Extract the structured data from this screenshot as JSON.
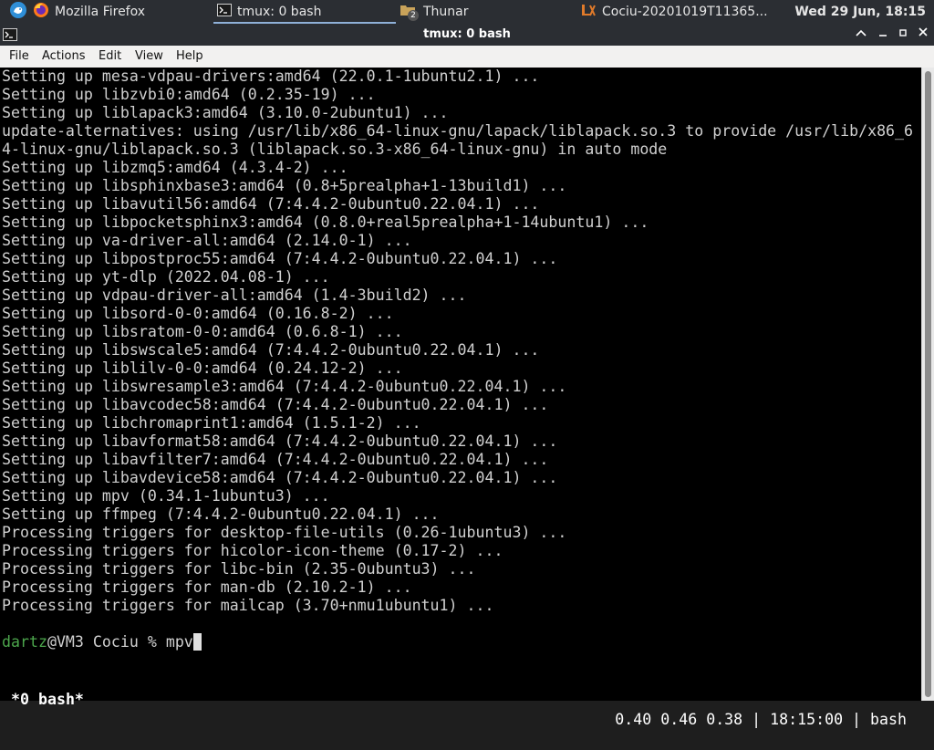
{
  "taskbar": {
    "items": [
      {
        "label": ""
      },
      {
        "label": "Mozilla Firefox"
      },
      {
        "label": "tmux: 0 bash"
      },
      {
        "label": "Thunar",
        "badge": "2"
      },
      {
        "label": "Cociu-20201019T11365..."
      }
    ],
    "clock": "Wed 29 Jun, 18:15"
  },
  "window": {
    "title": "tmux: 0 bash"
  },
  "menu": [
    "File",
    "Actions",
    "Edit",
    "View",
    "Help"
  ],
  "terminal": {
    "lines": [
      "Setting up mesa-vdpau-drivers:amd64 (22.0.1-1ubuntu2.1) ...",
      "Setting up libzvbi0:amd64 (0.2.35-19) ...",
      "Setting up liblapack3:amd64 (3.10.0-2ubuntu1) ...",
      "update-alternatives: using /usr/lib/x86_64-linux-gnu/lapack/liblapack.so.3 to provide /usr/lib/x86_6",
      "4-linux-gnu/liblapack.so.3 (liblapack.so.3-x86_64-linux-gnu) in auto mode",
      "Setting up libzmq5:amd64 (4.3.4-2) ...",
      "Setting up libsphinxbase3:amd64 (0.8+5prealpha+1-13build1) ...",
      "Setting up libavutil56:amd64 (7:4.4.2-0ubuntu0.22.04.1) ...",
      "Setting up libpocketsphinx3:amd64 (0.8.0+real5prealpha+1-14ubuntu1) ...",
      "Setting up va-driver-all:amd64 (2.14.0-1) ...",
      "Setting up libpostproc55:amd64 (7:4.4.2-0ubuntu0.22.04.1) ...",
      "Setting up yt-dlp (2022.04.08-1) ...",
      "Setting up vdpau-driver-all:amd64 (1.4-3build2) ...",
      "Setting up libsord-0-0:amd64 (0.16.8-2) ...",
      "Setting up libsratom-0-0:amd64 (0.6.8-1) ...",
      "Setting up libswscale5:amd64 (7:4.4.2-0ubuntu0.22.04.1) ...",
      "Setting up liblilv-0-0:amd64 (0.24.12-2) ...",
      "Setting up libswresample3:amd64 (7:4.4.2-0ubuntu0.22.04.1) ...",
      "Setting up libavcodec58:amd64 (7:4.4.2-0ubuntu0.22.04.1) ...",
      "Setting up libchromaprint1:amd64 (1.5.1-2) ...",
      "Setting up libavformat58:amd64 (7:4.4.2-0ubuntu0.22.04.1) ...",
      "Setting up libavfilter7:amd64 (7:4.4.2-0ubuntu0.22.04.1) ...",
      "Setting up libavdevice58:amd64 (7:4.4.2-0ubuntu0.22.04.1) ...",
      "Setting up mpv (0.34.1-1ubuntu3) ...",
      "Setting up ffmpeg (7:4.4.2-0ubuntu0.22.04.1) ...",
      "Processing triggers for desktop-file-utils (0.26-1ubuntu3) ...",
      "Processing triggers for hicolor-icon-theme (0.17-2) ...",
      "Processing triggers for libc-bin (2.35-0ubuntu3) ...",
      "Processing triggers for man-db (2.10.2-1) ...",
      "Processing triggers for mailcap (3.70+nmu1ubuntu1) ..."
    ],
    "prompt_user": "dartz",
    "prompt_rest": "@VM3 Cociu % ",
    "command": "mpv"
  },
  "tmux_status": {
    "left": "*0 bash*",
    "right": "0.40 0.46 0.38 | 18:15:00 | bash"
  },
  "colors": {
    "terminal_bg": "#000000",
    "terminal_fg": "#d0d0d0",
    "prompt_user": "#4ca64c",
    "panel_bg": "#2b2e33"
  }
}
